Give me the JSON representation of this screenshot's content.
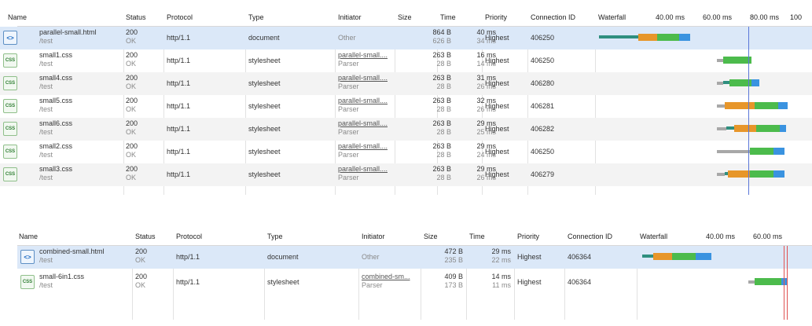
{
  "colors": {
    "queue": "#a8a8a8",
    "connect": "#2f8f7f",
    "wait": "#e7962a",
    "ttfb": "#4cbb4c",
    "download": "#3a93e0",
    "dom_line": "#5a76d8",
    "load_line": "#e05252",
    "selected": "#dbe8f8"
  },
  "panel1": {
    "headers": {
      "name": "Name",
      "status": "Status",
      "protocol": "Protocol",
      "type": "Type",
      "initiator": "Initiator",
      "size": "Size",
      "time": "Time",
      "priority": "Priority",
      "connection": "Connection ID",
      "waterfall": "Waterfall",
      "t1": "40.00 ms",
      "t2": "60.00 ms",
      "t3": "80.00 ms",
      "t4": "100"
    },
    "rows": [
      {
        "icon": "<>",
        "name": "parallel-small.html",
        "path": "/test",
        "status": "200",
        "status_text": "OK",
        "protocol": "http/1.1",
        "type": "document",
        "initiator": "Other",
        "initiator_sub": "",
        "size": "864 B",
        "size_sub": "626 B",
        "time": "40 ms",
        "time_sub": "34 ms",
        "priority": "Highest",
        "connection": "406250"
      },
      {
        "icon": "CSS",
        "name": "small1.css",
        "path": "/test",
        "status": "200",
        "status_text": "OK",
        "protocol": "http/1.1",
        "type": "stylesheet",
        "initiator": "parallel-small....",
        "initiator_sub": "Parser",
        "size": "263 B",
        "size_sub": "28 B",
        "time": "16 ms",
        "time_sub": "14 ms",
        "priority": "Highest",
        "connection": "406250"
      },
      {
        "icon": "CSS",
        "name": "small4.css",
        "path": "/test",
        "status": "200",
        "status_text": "OK",
        "protocol": "http/1.1",
        "type": "stylesheet",
        "initiator": "parallel-small....",
        "initiator_sub": "Parser",
        "size": "263 B",
        "size_sub": "28 B",
        "time": "31 ms",
        "time_sub": "26 ms",
        "priority": "Highest",
        "connection": "406280"
      },
      {
        "icon": "CSS",
        "name": "small5.css",
        "path": "/test",
        "status": "200",
        "status_text": "OK",
        "protocol": "http/1.1",
        "type": "stylesheet",
        "initiator": "parallel-small....",
        "initiator_sub": "Parser",
        "size": "263 B",
        "size_sub": "28 B",
        "time": "32 ms",
        "time_sub": "26 ms",
        "priority": "Highest",
        "connection": "406281"
      },
      {
        "icon": "CSS",
        "name": "small6.css",
        "path": "/test",
        "status": "200",
        "status_text": "OK",
        "protocol": "http/1.1",
        "type": "stylesheet",
        "initiator": "parallel-small....",
        "initiator_sub": "Parser",
        "size": "263 B",
        "size_sub": "28 B",
        "time": "29 ms",
        "time_sub": "25 ms",
        "priority": "Highest",
        "connection": "406282"
      },
      {
        "icon": "CSS",
        "name": "small2.css",
        "path": "/test",
        "status": "200",
        "status_text": "OK",
        "protocol": "http/1.1",
        "type": "stylesheet",
        "initiator": "parallel-small....",
        "initiator_sub": "Parser",
        "size": "263 B",
        "size_sub": "28 B",
        "time": "29 ms",
        "time_sub": "24 ms",
        "priority": "Highest",
        "connection": "406250"
      },
      {
        "icon": "CSS",
        "name": "small3.css",
        "path": "/test",
        "status": "200",
        "status_text": "OK",
        "protocol": "http/1.1",
        "type": "stylesheet",
        "initiator": "parallel-small....",
        "initiator_sub": "Parser",
        "size": "263 B",
        "size_sub": "28 B",
        "time": "29 ms",
        "time_sub": "26 ms",
        "priority": "Highest",
        "connection": "406279"
      }
    ]
  },
  "panel2": {
    "headers": {
      "name": "Name",
      "status": "Status",
      "protocol": "Protocol",
      "type": "Type",
      "initiator": "Initiator",
      "size": "Size",
      "time": "Time",
      "priority": "Priority",
      "connection": "Connection ID",
      "waterfall": "Waterfall",
      "t1": "40.00 ms",
      "t2": "60.00 ms"
    },
    "rows": [
      {
        "icon": "<>",
        "name": "combined-small.html",
        "path": "/test",
        "status": "200",
        "status_text": "OK",
        "protocol": "http/1.1",
        "type": "document",
        "initiator": "Other",
        "initiator_sub": "",
        "size": "472 B",
        "size_sub": "235 B",
        "time": "29 ms",
        "time_sub": "22 ms",
        "priority": "Highest",
        "connection": "406364"
      },
      {
        "icon": "CSS",
        "name": "small-6in1.css",
        "path": "/test",
        "status": "200",
        "status_text": "OK",
        "protocol": "http/1.1",
        "type": "stylesheet",
        "initiator": "combined-sm...",
        "initiator_sub": "Parser",
        "size": "409 B",
        "size_sub": "173 B",
        "time": "14 ms",
        "time_sub": "11 ms",
        "priority": "Highest",
        "connection": "406364"
      }
    ]
  }
}
